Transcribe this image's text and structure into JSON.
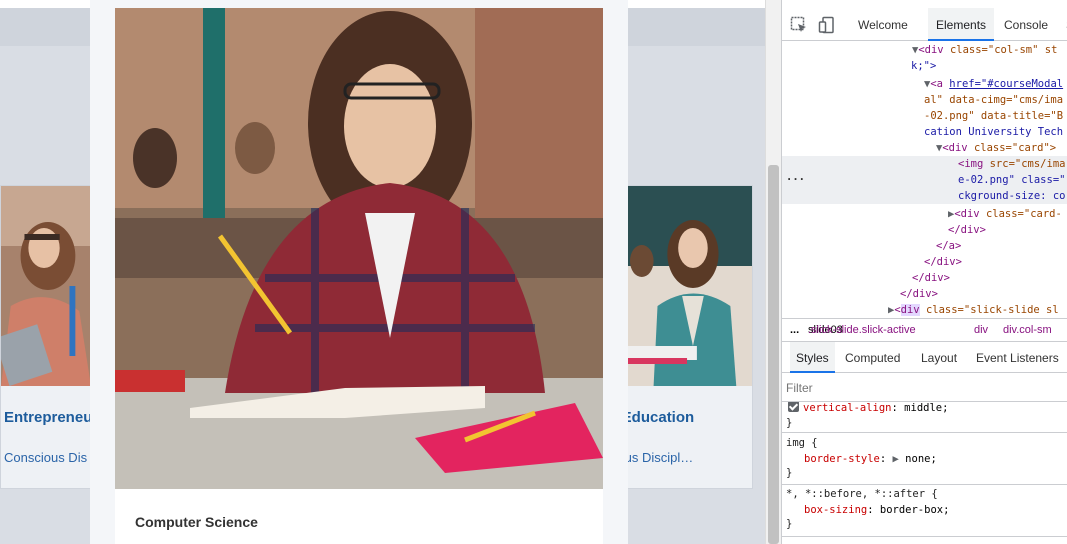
{
  "page": {
    "left_card": {
      "title": "Entrepreneu",
      "subtitle": "Conscious Dis"
    },
    "center_card": {
      "course_title": "Computer Science"
    },
    "right_card": {
      "title": "ic Education",
      "subtitle": "cious Discipl…"
    }
  },
  "devtools": {
    "tabs": {
      "welcome": "Welcome",
      "elements": "Elements",
      "console": "Console",
      "more": "S"
    },
    "dom_lines": [
      "class=\"col-sm\" st",
      "k;\">",
      "href=\"#courseModal",
      "al\" data-cimg=\"cms/ima",
      "-02.png\" data-title=\"B",
      "cation University Tech",
      "class=\"card\">",
      "src=\"cms/ima",
      "e-02.png\" class=\"",
      "ckground-size: co",
      "class=\"card-",
      "</div>",
      "</a>",
      "</div>",
      "</div>",
      "</div>",
      "class=\"slick-slide sl"
    ],
    "breadcrumbs": {
      "ellipsis": "...",
      "item1_prefix": "slide03",
      "item1_suffix": ".slick-slide.slick-active",
      "item2": "div",
      "item3": "div.col-sm"
    },
    "style_tabs": [
      "Styles",
      "Computed",
      "Layout",
      "Event Listeners"
    ],
    "filter_placeholder": "Filter",
    "rules": {
      "r0_prop": "vertical-align",
      "r0_val": "middle;",
      "r1_selector": "img {",
      "r1_prop": "border-style",
      "r1_val": "none;",
      "r2_selector": "*, *::before, *::after {",
      "r2_prop": "box-sizing",
      "r2_val": "border-box;",
      "close": "}"
    }
  }
}
